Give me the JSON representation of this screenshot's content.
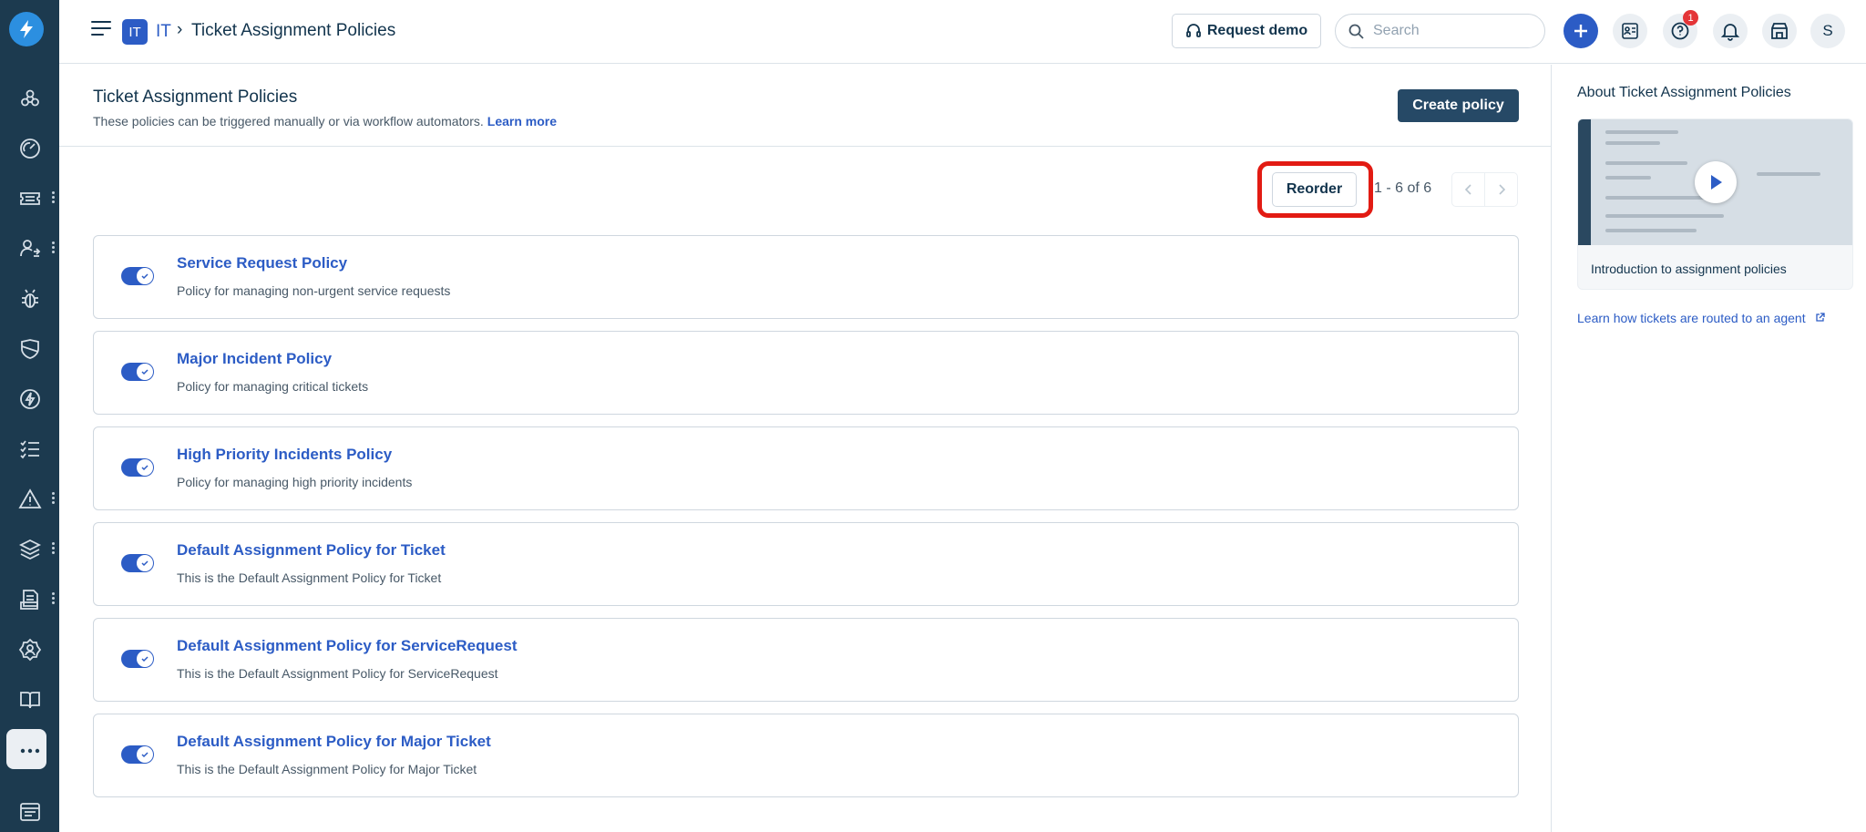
{
  "colors": {
    "rail": "#1c3a4f",
    "primary": "#2c5cc5",
    "highlight": "#e21b13",
    "dark_button": "#264966"
  },
  "rail": {
    "items": [
      {
        "name": "dashboard",
        "icon": "network-icon"
      },
      {
        "name": "gauge",
        "icon": "gauge-icon"
      },
      {
        "name": "tickets",
        "icon": "ticket-icon",
        "more": true
      },
      {
        "name": "users",
        "icon": "user-switch-icon",
        "more": true
      },
      {
        "name": "problems",
        "icon": "bug-icon"
      },
      {
        "name": "changes",
        "icon": "shield-icon"
      },
      {
        "name": "releases",
        "icon": "lightning-icon"
      },
      {
        "name": "tasks",
        "icon": "checklist-icon"
      },
      {
        "name": "alerts",
        "icon": "alert-icon",
        "more": true
      },
      {
        "name": "assets",
        "icon": "layers-icon",
        "more": true
      },
      {
        "name": "reports",
        "icon": "document-icon",
        "more": true
      },
      {
        "name": "admin",
        "icon": "gear-person-icon"
      },
      {
        "name": "solutions",
        "icon": "book-icon"
      },
      {
        "name": "more",
        "icon": "more-icon"
      },
      {
        "name": "catalog",
        "icon": "catalog-icon"
      }
    ]
  },
  "header": {
    "workspace_badge": "IT",
    "workspace_name": "IT",
    "breadcrumb_sep": "›",
    "title": "Ticket Assignment Policies",
    "request_demo": "Request demo",
    "search_placeholder": "Search",
    "help_badge": "1",
    "avatar": "S"
  },
  "page": {
    "title": "Ticket Assignment Policies",
    "description": "These policies can be triggered manually or via workflow automators.",
    "learn_more": "Learn more",
    "create_button": "Create policy",
    "reorder_button": "Reorder",
    "pagination": "1 - 6 of 6"
  },
  "policies": [
    {
      "title": "Service Request Policy",
      "description": "Policy for managing non-urgent service requests",
      "enabled": true
    },
    {
      "title": "Major Incident Policy",
      "description": "Policy for managing critical tickets",
      "enabled": true
    },
    {
      "title": "High Priority Incidents Policy",
      "description": "Policy for managing high priority incidents",
      "enabled": true
    },
    {
      "title": "Default Assignment Policy for Ticket",
      "description": "This is the Default Assignment Policy for Ticket",
      "enabled": true
    },
    {
      "title": "Default Assignment Policy for ServiceRequest",
      "description": "This is the Default Assignment Policy for ServiceRequest",
      "enabled": true
    },
    {
      "title": "Default Assignment Policy for Major Ticket",
      "description": "This is the Default Assignment Policy for Major Ticket",
      "enabled": true
    }
  ],
  "side": {
    "title": "About Ticket Assignment Policies",
    "video_caption": "Introduction to assignment policies",
    "link": "Learn how tickets are routed to an agent"
  }
}
